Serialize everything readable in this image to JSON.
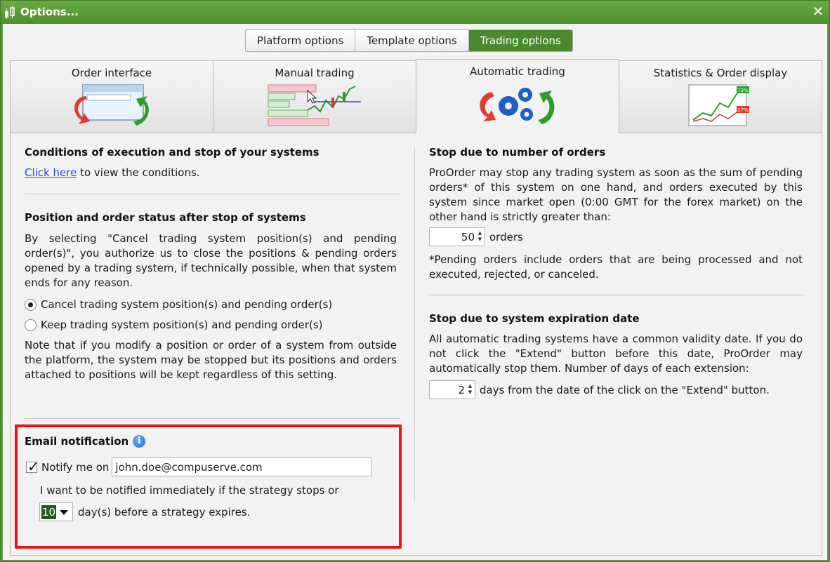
{
  "window": {
    "title": "Options...",
    "close_glyph": "✕"
  },
  "top_tabs": [
    {
      "label": "Platform options",
      "active": false
    },
    {
      "label": "Template options",
      "active": false
    },
    {
      "label": "Trading options",
      "active": true
    }
  ],
  "tabs": [
    {
      "label": "Order interface",
      "icon": "order-interface-icon",
      "active": false
    },
    {
      "label": "Manual trading",
      "icon": "manual-trading-icon",
      "active": false
    },
    {
      "label": "Automatic trading",
      "icon": "automatic-trading-icon",
      "active": true
    },
    {
      "label": "Statistics & Order display",
      "icon": "statistics-icon",
      "active": false
    }
  ],
  "left": {
    "conditions": {
      "heading": "Conditions of execution and stop of your systems",
      "link": "Click here",
      "link_suffix": " to view the conditions."
    },
    "position_status": {
      "heading": "Position and order status after stop of systems",
      "body": "By selecting \"Cancel trading system position(s) and pending order(s)\", you authorize us to close the positions & pending orders opened by a trading system, if technically possible, when that system ends for any reason.",
      "options": [
        {
          "label": "Cancel trading system position(s) and pending order(s)",
          "selected": true
        },
        {
          "label": "Keep trading system position(s) and pending order(s)",
          "selected": false
        }
      ],
      "note": "Note that if you modify a position or order of a system from outside the platform, the system may be stopped but its positions and orders attached to positions will be kept regardless of this setting."
    },
    "email": {
      "heading": "Email notification",
      "info_glyph": "i",
      "notify_label": "Notify me on",
      "notify_checked": true,
      "email_value": "john.doe@compuserve.com",
      "line1": "I want to be notified immediately if the strategy stops or",
      "days_value": "10",
      "line2": "day(s) before a strategy expires."
    }
  },
  "right": {
    "orders": {
      "heading": "Stop due to number of orders",
      "body": "ProOrder may stop any trading system as soon as the sum of pending orders* of this system on one hand, and orders executed by this system since market open (0:00 GMT for the forex market) on the other hand is strictly greater than:",
      "value": "50",
      "unit": "orders",
      "footnote": "*Pending orders include orders that are being processed and not executed, rejected, or canceled."
    },
    "expiration": {
      "heading": "Stop due to system expiration date",
      "body": "All automatic trading systems have a common validity date. If you do not click the \"Extend\" button before this date, ProOrder may automatically stop them. Number of days of each extension:",
      "value": "2",
      "suffix": "days from the date of the click on the \"Extend\" button."
    }
  },
  "icons": {
    "stat_badge_up": "73%",
    "stat_badge_down": "27%"
  },
  "colors": {
    "accent_green": "#4a8a2c",
    "highlight_red": "#e8141a",
    "link_blue": "#2a4fd6"
  }
}
